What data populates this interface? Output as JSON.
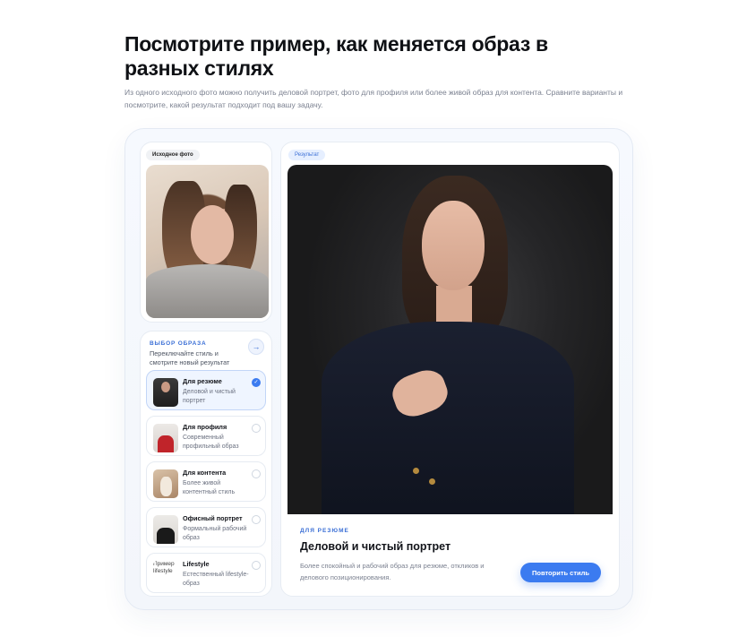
{
  "header": {
    "title": "Посмотрите пример, как меняется образ в разных стилях",
    "subtitle": "Из одного исходного фото можно получить деловой портрет, фото для профиля или более живой образ для контента. Сравните варианты и посмотрите, какой результат подходит под вашу задачу."
  },
  "source": {
    "badge": "Исходное фото"
  },
  "styles": {
    "heading": "ВЫБОР ОБРАЗА",
    "hint": "Переключайте стиль и смотрите новый результат",
    "next_icon": "arrow-right-icon",
    "options": [
      {
        "title": "Для резюме",
        "desc": "Деловой и чистый портрет",
        "active": true
      },
      {
        "title": "Для профиля",
        "desc": "Современный профильный образ",
        "active": false
      },
      {
        "title": "Для контента",
        "desc": "Более живой контентный стиль",
        "active": false
      },
      {
        "title": "Офисный портрет",
        "desc": "Формальный рабочий образ",
        "active": false
      },
      {
        "title": "Lifestyle",
        "desc": "Естественный lifestyle-образ",
        "active": false,
        "thumb_alt": "Пример lifestyle"
      }
    ]
  },
  "result": {
    "badge": "Результат",
    "caption": "ДЛЯ РЕЗЮМЕ",
    "title": "Деловой и чистый портрет",
    "description": "Более спокойный и рабочий образ для резюме, откликов и делового позиционирования.",
    "button": "Повторить стиль"
  },
  "colors": {
    "accent": "#3b7bf0",
    "accent_text": "#3b6fd6",
    "text_primary": "#12141a",
    "text_muted": "#7b8190"
  }
}
